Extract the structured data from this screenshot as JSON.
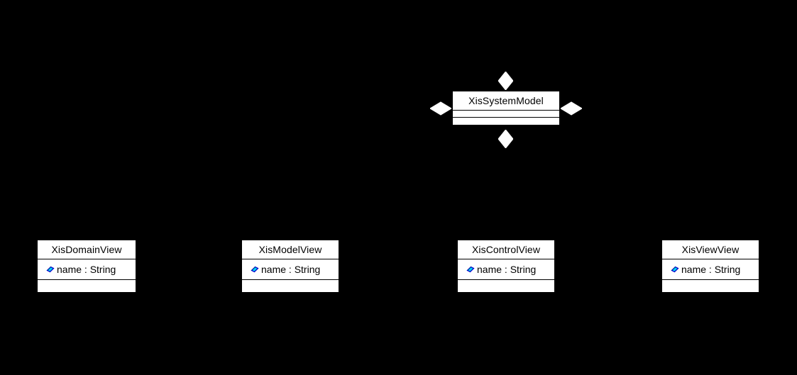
{
  "diagram": {
    "type": "uml-class-diagram",
    "background_color": "#000000",
    "class_fill_color": "#ffffff",
    "line_color": "#000000",
    "text_color": "#000000",
    "attribute_icon_color": "#00e5ee",
    "attribute_icon_name": "attribute-icon"
  },
  "root_class": {
    "name": "XisSystemModel",
    "attributes": [],
    "operations": [],
    "adornments": [
      {
        "name": "composition-diamond-top",
        "position": "top",
        "filled": true
      },
      {
        "name": "composition-diamond-bottom",
        "position": "bottom",
        "filled": true
      },
      {
        "name": "composition-diamond-left",
        "position": "left",
        "filled": true
      },
      {
        "name": "composition-diamond-right",
        "position": "right",
        "filled": true
      }
    ]
  },
  "classes": [
    {
      "name": "XisDomainView",
      "attributes": [
        {
          "icon": "attribute-icon",
          "label": "name : String"
        }
      ],
      "operations": []
    },
    {
      "name": "XisModelView",
      "attributes": [
        {
          "icon": "attribute-icon",
          "label": "name : String"
        }
      ],
      "operations": []
    },
    {
      "name": "XisControlView",
      "attributes": [
        {
          "icon": "attribute-icon",
          "label": "name : String"
        }
      ],
      "operations": []
    },
    {
      "name": "XisViewView",
      "attributes": [
        {
          "icon": "attribute-icon",
          "label": "name : String"
        }
      ],
      "operations": []
    }
  ]
}
